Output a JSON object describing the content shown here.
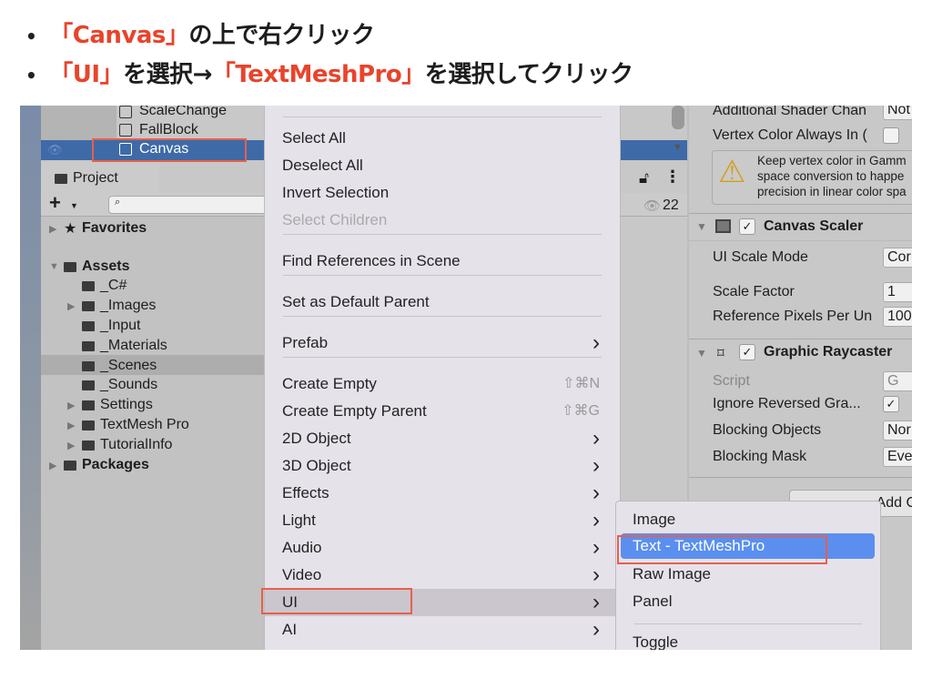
{
  "slide": {
    "bullet1": {
      "red": "「Canvas」",
      "rest": "の上で右クリック"
    },
    "bullet2": {
      "red1": "「UI」",
      "mid": "を選択→",
      "red2": "「TextMeshPro」",
      "rest": "を選択してクリック"
    }
  },
  "hierarchy": {
    "items": [
      "ScaleChange",
      "FallBlock",
      "Canvas"
    ],
    "selected": "Canvas"
  },
  "project": {
    "tab": "Project",
    "add": "+",
    "search_placeholder": "",
    "visible_count": "22",
    "tree": [
      {
        "label": "Favorites",
        "bold": true
      },
      {
        "label": "Assets",
        "bold": true
      },
      {
        "label": "_C#"
      },
      {
        "label": "_Images"
      },
      {
        "label": "_Input"
      },
      {
        "label": "_Materials"
      },
      {
        "label": "_Scenes",
        "selected": true
      },
      {
        "label": "_Sounds"
      },
      {
        "label": "Settings"
      },
      {
        "label": "TextMesh Pro"
      },
      {
        "label": "TutorialInfo"
      },
      {
        "label": "Packages",
        "bold": true
      }
    ]
  },
  "context_menu": {
    "items": [
      "Select All",
      "Deselect All",
      "Invert Selection",
      "Select Children",
      "Find References in Scene",
      "Set as Default Parent",
      "Prefab",
      "Create Empty",
      "Create Empty Parent",
      "2D Object",
      "3D Object",
      "Effects",
      "Light",
      "Audio",
      "Video",
      "UI",
      "AI"
    ],
    "shortcut_create_empty": "⇧⌘N",
    "shortcut_create_empty_parent": "⇧⌘G",
    "highlighted": "UI"
  },
  "submenu": {
    "items": [
      "Image",
      "Text - TextMeshPro",
      "Raw Image",
      "Panel",
      "Toggle"
    ],
    "highlighted": "Text - TextMeshPro"
  },
  "inspector": {
    "additional_shader": "Additional Shader Chan",
    "additional_shader_value": "Not",
    "vertex_color": "Vertex Color Always In (",
    "warning": [
      "Keep vertex color in Gamm",
      "space conversion to happe",
      "precision in linear color spa"
    ],
    "canvas_scaler": "Canvas Scaler",
    "ui_scale_mode": "UI Scale Mode",
    "ui_scale_mode_value": "Cor",
    "scale_factor": "Scale Factor",
    "scale_factor_value": "1",
    "ref_pixels": "Reference Pixels Per Un",
    "ref_pixels_value": "100",
    "graphic_raycaster": "Graphic Raycaster",
    "script": "Script",
    "script_value": "G",
    "ignore_reversed": "Ignore Reversed Gra...",
    "blocking_objects": "Blocking Objects",
    "blocking_objects_value": "Nor",
    "blocking_mask": "Blocking Mask",
    "blocking_mask_value": "Eve",
    "add_component": "Add C"
  },
  "colors": {
    "accent_red": "#e8442c",
    "selection_blue": "#3e6aa8",
    "menu_highlight": "#5a8ff0"
  }
}
